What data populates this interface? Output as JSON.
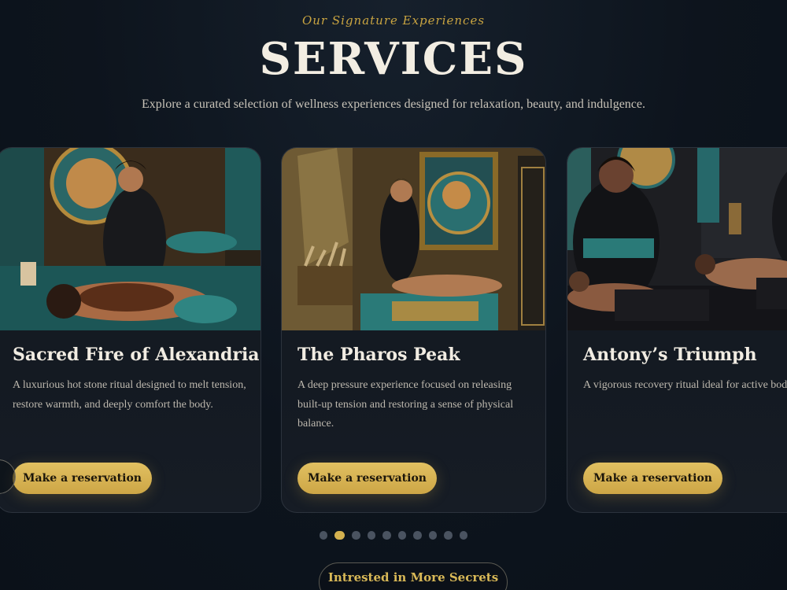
{
  "header": {
    "eyebrow": "Our Signature Experiences",
    "title": "SERVICES",
    "subtitle": "Explore a curated selection of wellness experiences designed for relaxation, beauty, and indulgence."
  },
  "cards": [
    {
      "title": "Sacred Fire of Alexandria",
      "description": "A luxurious hot stone ritual designed to melt tension, restore warmth, and deeply comfort the body.",
      "button": "Make a reservation"
    },
    {
      "title": "The Pharos Peak",
      "description": "A deep pressure experience focused on releasing built-up tension and restoring a sense of physical balance.",
      "button": "Make a reservation"
    },
    {
      "title": "Antony’s Triumph",
      "description": "A vigorous recovery ritual ideal for active body seeking flexibility, movement, and renewal.",
      "button": "Make a reservation"
    }
  ],
  "pagination": {
    "total": 10,
    "active_index": 1
  },
  "more_button": "Intrested in More Secrets",
  "colors": {
    "gold": "#d4b14f",
    "background": "#0d141d",
    "teal": "#1f6d6e"
  }
}
